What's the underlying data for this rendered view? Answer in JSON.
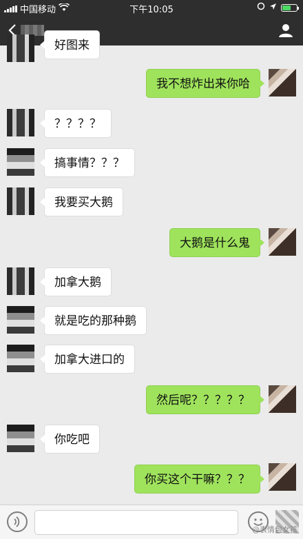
{
  "status": {
    "carrier": "中国移动",
    "time": "下午10:05",
    "battery_level": 0.6
  },
  "top_partial_text": "好图来",
  "messages": [
    {
      "side": "out",
      "text": "我不想炸出来你哈"
    },
    {
      "side": "in",
      "text": "？？？？"
    },
    {
      "side": "in",
      "text": "搞事情？？？"
    },
    {
      "side": "in",
      "text": "我要买大鹅"
    },
    {
      "side": "out",
      "text": "大鹅是什么鬼"
    },
    {
      "side": "in",
      "text": "加拿大鹅"
    },
    {
      "side": "in",
      "text": "就是吃的那种鹅"
    },
    {
      "side": "in",
      "text": "加拿大进口的"
    },
    {
      "side": "out",
      "text": "然后呢？？？？？"
    },
    {
      "side": "in",
      "text": "你吃吧"
    },
    {
      "side": "out",
      "text": "你买这个干嘛？？？"
    }
  ],
  "icons": [
    "back-icon",
    "profile-icon",
    "voice-icon",
    "emoji-icon",
    "plus-icon",
    "wifi-icon",
    "battery-icon"
  ],
  "watermark": "@表情包女孩"
}
